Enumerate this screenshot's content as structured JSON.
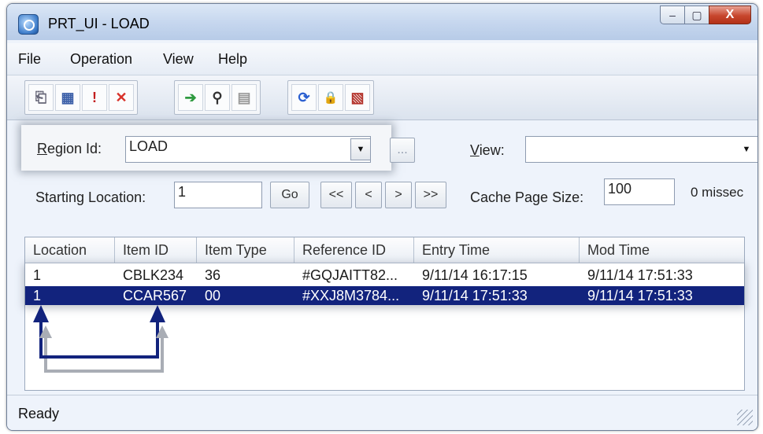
{
  "window": {
    "title": "PRT_UI - LOAD",
    "minimize": "–",
    "maximize": "▢",
    "close": "X"
  },
  "menu": [
    "File",
    "Operation",
    "View",
    "Help"
  ],
  "toolbar": {
    "buttons": [
      {
        "icon": "new-record-icon",
        "glyph": "⎗"
      },
      {
        "icon": "calendar-icon",
        "glyph": "▦"
      },
      {
        "icon": "alert-icon",
        "glyph": "!"
      },
      {
        "icon": "delete-icon",
        "glyph": "✕"
      },
      {
        "icon": "forward-arrow-icon",
        "glyph": "➔"
      },
      {
        "icon": "binoculars-find-icon",
        "glyph": "⚲"
      },
      {
        "icon": "find-next-icon",
        "glyph": "▤"
      },
      {
        "icon": "refresh-icon",
        "glyph": "⟳"
      },
      {
        "icon": "lock-icon",
        "glyph": "🔒"
      },
      {
        "icon": "clear-icon",
        "glyph": "▧"
      }
    ],
    "accent": {
      "delete": "#d8322a",
      "forward": "#2f9a40",
      "lock": "#e8b400",
      "refresh": "#2a5fd0"
    }
  },
  "region": {
    "label_prefix": "R",
    "label_rest": "egion Id:",
    "value": "LOAD",
    "browse": "..."
  },
  "view": {
    "label_prefix": "V",
    "label_rest": "iew:",
    "value": ""
  },
  "start": {
    "label": "Starting Location:",
    "value": "1",
    "go": "Go"
  },
  "nav": {
    "first": "<<",
    "prev": "<",
    "next": ">",
    "last": ">>"
  },
  "cache": {
    "label": "Cache Page Size:",
    "value": "100",
    "missed": "0 missec"
  },
  "table": {
    "columns": [
      "Location",
      "Item ID",
      "Item Type",
      "Reference ID",
      "Entry Time",
      "Mod Time"
    ],
    "rows": [
      [
        "1",
        "CBLK234",
        "36",
        "#GQJAITT82...",
        "9/11/14 16:17:15",
        "9/11/14 17:51:33"
      ],
      [
        "1",
        "CCAR567",
        "00",
        "#XXJ8M3784...",
        "9/11/14 17:51:33",
        "9/11/14 17:51:33"
      ]
    ],
    "selected_row": 1
  },
  "status": {
    "text": "Ready"
  },
  "colors": {
    "selection": "#12237d",
    "annotation_arrow": "#12237d",
    "annotation_shadow": "#a9adb5"
  }
}
